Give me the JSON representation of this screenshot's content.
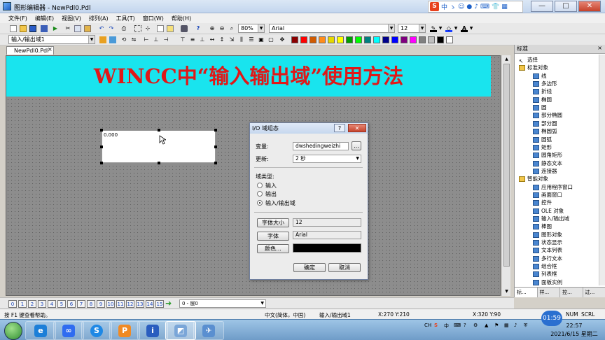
{
  "window": {
    "title": "图形编辑器 - NewPdl0.Pdl",
    "minimize": "—",
    "maximize": "□",
    "close": "✕"
  },
  "ime": {
    "s": "S",
    "zh": "中",
    "icons": [
      "ゝ",
      "☺",
      "●",
      "♪",
      "⌨",
      "👕",
      "▦"
    ]
  },
  "menu": [
    "文件(F)",
    "编辑(E)",
    "视图(V)",
    "排列(A)",
    "工具(T)",
    "窗口(W)",
    "帮助(H)"
  ],
  "toolbar1": {
    "zoom": "80%",
    "font": "Arial",
    "font_size": "12"
  },
  "toolbar2": {
    "object_combo": "输入/输出域1"
  },
  "colors": [
    "#8b0000",
    "#ff0000",
    "#d05a00",
    "#ff8c1a",
    "#e6d800",
    "#ffff00",
    "#00a000",
    "#00ff00",
    "#008080",
    "#00ffff",
    "#00008b",
    "#0000ff",
    "#800080",
    "#ff00ff",
    "#808080",
    "#c0c0c0",
    "#000000",
    "#ffffff"
  ],
  "doc_tab": {
    "label": "NewPdl0.Pdl",
    "close": "×"
  },
  "canvas": {
    "banner": "WINCC中“输入输出域”使用方法",
    "io_field_value": "0.000"
  },
  "dialog": {
    "title": "I/O 域组态",
    "help": "?",
    "close": "✕",
    "var_label": "变量:",
    "var_value": "dwshedingweizhi",
    "browse": "...",
    "update_label": "更新:",
    "update_value": "2 秒",
    "type_label": "域类型:",
    "type_options": [
      "输入",
      "输出",
      "输入/输出域"
    ],
    "font_size_btn": "字体大小",
    "font_size_value": "12",
    "font_btn": "字体",
    "font_value": "Arial",
    "color_btn": "颜色...",
    "ok": "确定",
    "cancel": "取消"
  },
  "pages": [
    "0",
    "1",
    "2",
    "3",
    "4",
    "5",
    "6",
    "7",
    "8",
    "9",
    "10",
    "11",
    "12",
    "13",
    "14",
    "15"
  ],
  "layer": "0 - 层0",
  "status": {
    "help": "按 F1 键查看帮助。",
    "lang": "中文(简体，中国)",
    "object": "输入/输出域1",
    "pos": "X:270 Y:210",
    "size": "X:320 Y:90",
    "num": "NUM",
    "scrl": "SCRL"
  },
  "palette": {
    "title": "标准",
    "close": "×",
    "items": [
      {
        "label": "选择",
        "indent": 0
      },
      {
        "label": "标准对象",
        "indent": 0
      },
      {
        "label": "线",
        "indent": 1
      },
      {
        "label": "多边形",
        "indent": 1
      },
      {
        "label": "折线",
        "indent": 1
      },
      {
        "label": "椭圆",
        "indent": 1
      },
      {
        "label": "圆",
        "indent": 1
      },
      {
        "label": "部分椭圆",
        "indent": 1
      },
      {
        "label": "部分圆",
        "indent": 1
      },
      {
        "label": "椭圆弧",
        "indent": 1
      },
      {
        "label": "圆弧",
        "indent": 1
      },
      {
        "label": "矩形",
        "indent": 1
      },
      {
        "label": "圆角矩形",
        "indent": 1
      },
      {
        "label": "静态文本",
        "indent": 1
      },
      {
        "label": "连接器",
        "indent": 1
      },
      {
        "label": "智能对象",
        "indent": 0
      },
      {
        "label": "应用程序窗口",
        "indent": 1
      },
      {
        "label": "画面窗口",
        "indent": 1
      },
      {
        "label": "控件",
        "indent": 1
      },
      {
        "label": "OLE 对象",
        "indent": 1
      },
      {
        "label": "输入/输出域",
        "indent": 1
      },
      {
        "label": "棒图",
        "indent": 1
      },
      {
        "label": "图形对象",
        "indent": 1
      },
      {
        "label": "状态显示",
        "indent": 1
      },
      {
        "label": "文本列表",
        "indent": 1
      },
      {
        "label": "多行文本",
        "indent": 1
      },
      {
        "label": "组合框",
        "indent": 1
      },
      {
        "label": "列表框",
        "indent": 1
      },
      {
        "label": "面板实例",
        "indent": 1
      }
    ],
    "tabs": [
      "标...",
      "样...",
      "控...",
      "过..."
    ]
  },
  "taskbar": {
    "tray_lang": "CH",
    "time": "22:57",
    "date": "2021/6/15 星期二",
    "rec_time": "01:59"
  }
}
